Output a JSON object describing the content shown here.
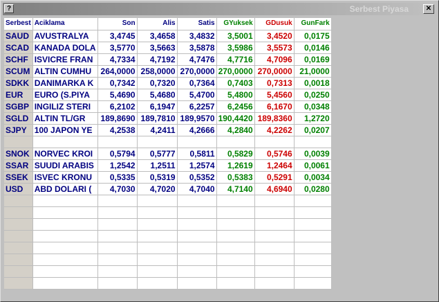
{
  "window": {
    "title": "Serbest Piyasa",
    "sys_label": "?",
    "close_label": "✕"
  },
  "colors": {
    "positive": "#008000",
    "negative": "#cc0000",
    "text": "#000080"
  },
  "columns": [
    "Serbest",
    "Aciklama",
    "Son",
    "Alis",
    "Satis",
    "GYuksek",
    "GDusuk",
    "GunFark"
  ],
  "rows": [
    [
      "SAUD",
      "AVUSTRALYA",
      "3,4745",
      "3,4658",
      "3,4832",
      "3,5001",
      "3,4520",
      "0,0175"
    ],
    [
      "SCAD",
      "KANADA DOLA",
      "3,5770",
      "3,5663",
      "3,5878",
      "3,5986",
      "3,5573",
      "0,0146"
    ],
    [
      "SCHF",
      "ISVICRE FRAN",
      "4,7334",
      "4,7192",
      "4,7476",
      "4,7716",
      "4,7096",
      "0,0169"
    ],
    [
      "SCUM",
      "ALTIN CUMHU",
      "264,0000",
      "258,0000",
      "270,0000",
      "270,0000",
      "270,0000",
      "21,0000"
    ],
    [
      "SDKK",
      "DANIMARKA K",
      "0,7342",
      "0,7320",
      "0,7364",
      "0,7403",
      "0,7313",
      "0,0018"
    ],
    [
      "EUR",
      "EURO (S.PIYA",
      "5,4690",
      "5,4680",
      "5,4700",
      "5,4800",
      "5,4560",
      "0,0250"
    ],
    [
      "SGBP",
      "INGILIZ STERI",
      "6,2102",
      "6,1947",
      "6,2257",
      "6,2456",
      "6,1670",
      "0,0348"
    ],
    [
      "SGLD",
      "ALTIN TL/GR",
      "189,8690",
      "189,7810",
      "189,9570",
      "190,4420",
      "189,8360",
      "1,2720"
    ],
    [
      "SJPY",
      "100 JAPON YE",
      "4,2538",
      "4,2411",
      "4,2666",
      "4,2840",
      "4,2262",
      "0,0207"
    ],
    [
      "",
      "",
      "",
      "",
      "",
      "",
      "",
      ""
    ],
    [
      "SNOK",
      "NORVEC KROI",
      "0,5794",
      "0,5777",
      "0,5811",
      "0,5829",
      "0,5746",
      "0,0039"
    ],
    [
      "SSAR",
      "SUUDI ARABIS",
      "1,2542",
      "1,2511",
      "1,2574",
      "1,2619",
      "1,2464",
      "0,0061"
    ],
    [
      "SSEK",
      "ISVEC KRONU",
      "0,5335",
      "0,5319",
      "0,5352",
      "0,5383",
      "0,5291",
      "0,0034"
    ],
    [
      "USD",
      "ABD DOLARI (",
      "4,7030",
      "4,7020",
      "4,7040",
      "4,7140",
      "4,6940",
      "0,0280"
    ],
    [
      "",
      "",
      "",
      "",
      "",
      "",
      "",
      ""
    ],
    [
      "",
      "",
      "",
      "",
      "",
      "",
      "",
      ""
    ],
    [
      "",
      "",
      "",
      "",
      "",
      "",
      "",
      ""
    ],
    [
      "",
      "",
      "",
      "",
      "",
      "",
      "",
      ""
    ],
    [
      "",
      "",
      "",
      "",
      "",
      "",
      "",
      ""
    ],
    [
      "",
      "",
      "",
      "",
      "",
      "",
      "",
      ""
    ],
    [
      "",
      "",
      "",
      "",
      "",
      "",
      "",
      ""
    ],
    [
      "",
      "",
      "",
      "",
      "",
      "",
      "",
      ""
    ]
  ]
}
